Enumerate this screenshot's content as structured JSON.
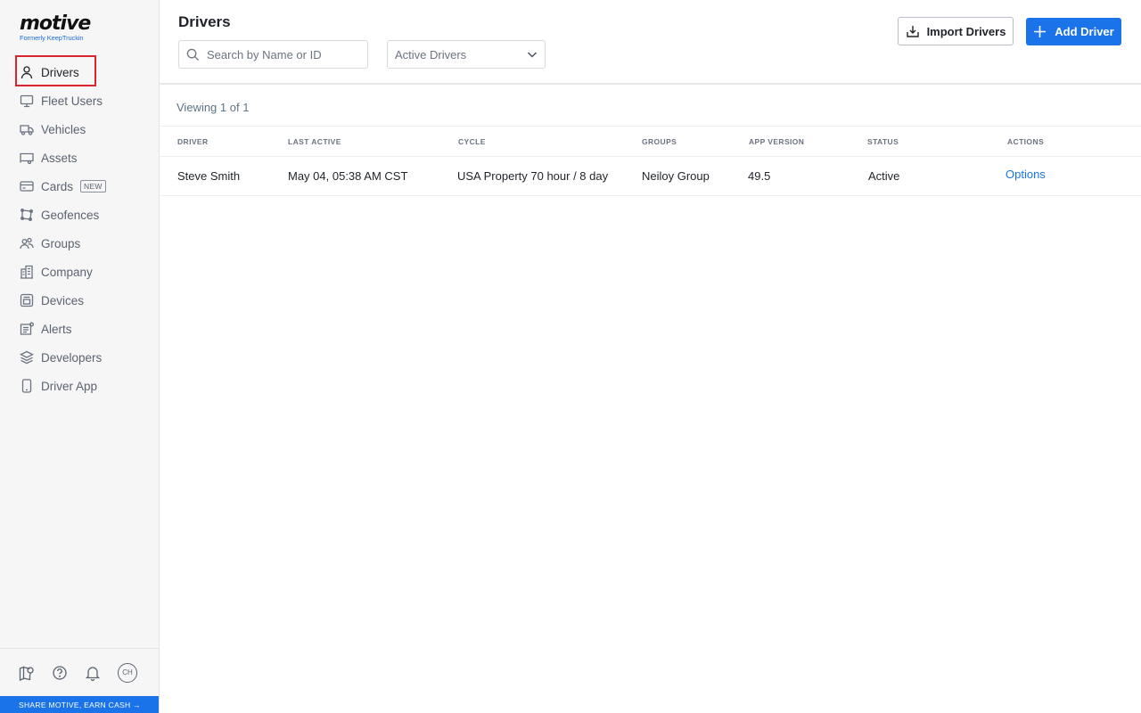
{
  "brand": {
    "name": "motive",
    "tagline": "Formerly KeepTruckin"
  },
  "sidebar": {
    "items": [
      {
        "label": "Drivers",
        "icon": "person-icon",
        "active": true
      },
      {
        "label": "Fleet Users",
        "icon": "monitor-icon"
      },
      {
        "label": "Vehicles",
        "icon": "truck-icon"
      },
      {
        "label": "Assets",
        "icon": "trailer-icon"
      },
      {
        "label": "Cards",
        "icon": "card-icon",
        "badge": "NEW"
      },
      {
        "label": "Geofences",
        "icon": "geofence-icon"
      },
      {
        "label": "Groups",
        "icon": "users-icon"
      },
      {
        "label": "Company",
        "icon": "building-icon"
      },
      {
        "label": "Devices",
        "icon": "device-icon"
      },
      {
        "label": "Alerts",
        "icon": "alert-icon"
      },
      {
        "label": "Developers",
        "icon": "layers-icon"
      },
      {
        "label": "Driver App",
        "icon": "phone-icon"
      }
    ],
    "footer": {
      "avatar_initials": "CH",
      "share_text": "SHARE MOTIVE, EARN CASH →"
    }
  },
  "page": {
    "title": "Drivers",
    "search_placeholder": "Search by Name or ID",
    "filter_selected": "Active Drivers",
    "import_label": "Import Drivers",
    "add_label": "Add Driver",
    "viewing": "Viewing 1 of 1"
  },
  "table": {
    "columns": [
      "DRIVER",
      "LAST ACTIVE",
      "CYCLE",
      "GROUPS",
      "APP VERSION",
      "STATUS",
      "ACTIONS"
    ],
    "rows": [
      {
        "driver": "Steve Smith",
        "last_active": "May 04, 05:38 AM CST",
        "cycle": "USA Property 70 hour / 8 day",
        "groups": "Neiloy Group",
        "app_version": "49.5",
        "status": "Active",
        "actions": "Options"
      }
    ]
  },
  "colors": {
    "accent": "#1a73e8",
    "highlight_border": "#d7262e"
  }
}
